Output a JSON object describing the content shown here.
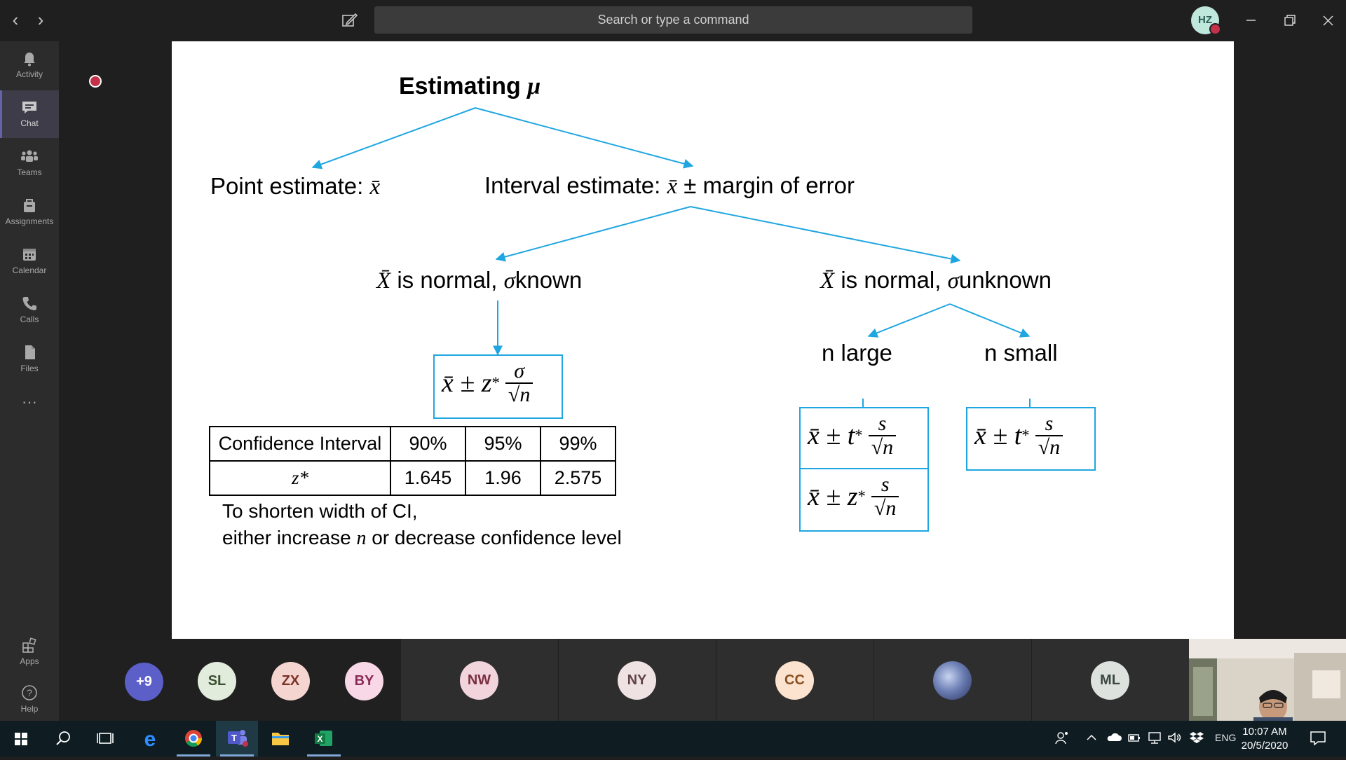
{
  "window": {
    "search_placeholder": "Search or type a command",
    "user_initials": "HZ"
  },
  "rail": {
    "items": [
      {
        "label": "Activity"
      },
      {
        "label": "Chat"
      },
      {
        "label": "Teams"
      },
      {
        "label": "Assignments"
      },
      {
        "label": "Calendar"
      },
      {
        "label": "Calls"
      },
      {
        "label": "Files"
      },
      {
        "label": "Apps"
      },
      {
        "label": "Help"
      }
    ],
    "more": "···"
  },
  "slide": {
    "title_prefix": "Estimating",
    "title_symbol": "μ",
    "point_label": "Point estimate:",
    "interval_label": "Interval estimate:",
    "interval_suffix": "± margin of error",
    "xbar": "x̄",
    "Xbar": "X̄",
    "known_mid": "is normal,",
    "sigma": "σ",
    "known_tail": "known",
    "unknown_tail": "unknown",
    "n_large": "n large",
    "n_small": "n small",
    "formula_z_sigma": {
      "lhs": "x̄ ± z",
      "star": "*",
      "num": "σ",
      "den": "√n"
    },
    "formula_t_large": {
      "lhs": "x̄ ± t",
      "star": "*",
      "num": "s",
      "den": "√n"
    },
    "formula_z_large": {
      "lhs": "x̄ ± z",
      "star": "*",
      "num": "s",
      "den": "√n"
    },
    "formula_t_small": {
      "lhs": "x̄ ± t",
      "star": "*",
      "num": "s",
      "den": "√n"
    },
    "table": {
      "header": [
        "Confidence Interval",
        "90%",
        "95%",
        "99%"
      ],
      "row": [
        "z*",
        "1.645",
        "1.96",
        "2.575"
      ]
    },
    "note_line1": "To shorten width of CI,",
    "note_line2_a": "either increase",
    "note_line2_n": "n",
    "note_line2_b": "or decrease confidence level"
  },
  "participants": [
    {
      "initials": "+9",
      "bg": "#5b5fc7",
      "fg": "#ffffff"
    },
    {
      "initials": "SL",
      "bg": "#e2ecdc",
      "fg": "#3b4f31"
    },
    {
      "initials": "ZX",
      "bg": "#f5d5cf",
      "fg": "#7a3326"
    },
    {
      "initials": "BY",
      "bg": "#f8d8e6",
      "fg": "#8a2a56"
    },
    {
      "initials": "NW",
      "bg": "#f2d5dc",
      "fg": "#7a2f41"
    },
    {
      "initials": "NY",
      "bg": "#efe2e3",
      "fg": "#5f4546"
    },
    {
      "initials": "CC",
      "bg": "#fbe3d0",
      "fg": "#8a4e1f"
    },
    {
      "initials": "ML",
      "bg": "#dde2df",
      "fg": "#3c4a43"
    }
  ],
  "taskbar": {
    "lang": "ENG",
    "time": "10:07 AM",
    "date": "20/5/2020"
  },
  "colors": {
    "accent": "#6264a7",
    "slide_line": "#1fa6e0",
    "status_red": "#c4314b"
  }
}
